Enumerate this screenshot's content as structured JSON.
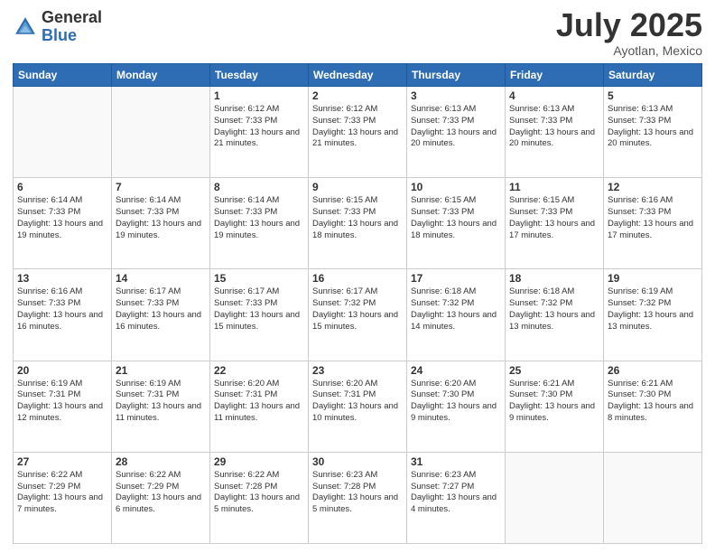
{
  "header": {
    "logo_general": "General",
    "logo_blue": "Blue",
    "title": "July 2025",
    "location": "Ayotlan, Mexico"
  },
  "days_of_week": [
    "Sunday",
    "Monday",
    "Tuesday",
    "Wednesday",
    "Thursday",
    "Friday",
    "Saturday"
  ],
  "weeks": [
    [
      {
        "day": "",
        "info": ""
      },
      {
        "day": "",
        "info": ""
      },
      {
        "day": "1",
        "info": "Sunrise: 6:12 AM\nSunset: 7:33 PM\nDaylight: 13 hours and 21 minutes."
      },
      {
        "day": "2",
        "info": "Sunrise: 6:12 AM\nSunset: 7:33 PM\nDaylight: 13 hours and 21 minutes."
      },
      {
        "day": "3",
        "info": "Sunrise: 6:13 AM\nSunset: 7:33 PM\nDaylight: 13 hours and 20 minutes."
      },
      {
        "day": "4",
        "info": "Sunrise: 6:13 AM\nSunset: 7:33 PM\nDaylight: 13 hours and 20 minutes."
      },
      {
        "day": "5",
        "info": "Sunrise: 6:13 AM\nSunset: 7:33 PM\nDaylight: 13 hours and 20 minutes."
      }
    ],
    [
      {
        "day": "6",
        "info": "Sunrise: 6:14 AM\nSunset: 7:33 PM\nDaylight: 13 hours and 19 minutes."
      },
      {
        "day": "7",
        "info": "Sunrise: 6:14 AM\nSunset: 7:33 PM\nDaylight: 13 hours and 19 minutes."
      },
      {
        "day": "8",
        "info": "Sunrise: 6:14 AM\nSunset: 7:33 PM\nDaylight: 13 hours and 19 minutes."
      },
      {
        "day": "9",
        "info": "Sunrise: 6:15 AM\nSunset: 7:33 PM\nDaylight: 13 hours and 18 minutes."
      },
      {
        "day": "10",
        "info": "Sunrise: 6:15 AM\nSunset: 7:33 PM\nDaylight: 13 hours and 18 minutes."
      },
      {
        "day": "11",
        "info": "Sunrise: 6:15 AM\nSunset: 7:33 PM\nDaylight: 13 hours and 17 minutes."
      },
      {
        "day": "12",
        "info": "Sunrise: 6:16 AM\nSunset: 7:33 PM\nDaylight: 13 hours and 17 minutes."
      }
    ],
    [
      {
        "day": "13",
        "info": "Sunrise: 6:16 AM\nSunset: 7:33 PM\nDaylight: 13 hours and 16 minutes."
      },
      {
        "day": "14",
        "info": "Sunrise: 6:17 AM\nSunset: 7:33 PM\nDaylight: 13 hours and 16 minutes."
      },
      {
        "day": "15",
        "info": "Sunrise: 6:17 AM\nSunset: 7:33 PM\nDaylight: 13 hours and 15 minutes."
      },
      {
        "day": "16",
        "info": "Sunrise: 6:17 AM\nSunset: 7:32 PM\nDaylight: 13 hours and 15 minutes."
      },
      {
        "day": "17",
        "info": "Sunrise: 6:18 AM\nSunset: 7:32 PM\nDaylight: 13 hours and 14 minutes."
      },
      {
        "day": "18",
        "info": "Sunrise: 6:18 AM\nSunset: 7:32 PM\nDaylight: 13 hours and 13 minutes."
      },
      {
        "day": "19",
        "info": "Sunrise: 6:19 AM\nSunset: 7:32 PM\nDaylight: 13 hours and 13 minutes."
      }
    ],
    [
      {
        "day": "20",
        "info": "Sunrise: 6:19 AM\nSunset: 7:31 PM\nDaylight: 13 hours and 12 minutes."
      },
      {
        "day": "21",
        "info": "Sunrise: 6:19 AM\nSunset: 7:31 PM\nDaylight: 13 hours and 11 minutes."
      },
      {
        "day": "22",
        "info": "Sunrise: 6:20 AM\nSunset: 7:31 PM\nDaylight: 13 hours and 11 minutes."
      },
      {
        "day": "23",
        "info": "Sunrise: 6:20 AM\nSunset: 7:31 PM\nDaylight: 13 hours and 10 minutes."
      },
      {
        "day": "24",
        "info": "Sunrise: 6:20 AM\nSunset: 7:30 PM\nDaylight: 13 hours and 9 minutes."
      },
      {
        "day": "25",
        "info": "Sunrise: 6:21 AM\nSunset: 7:30 PM\nDaylight: 13 hours and 9 minutes."
      },
      {
        "day": "26",
        "info": "Sunrise: 6:21 AM\nSunset: 7:30 PM\nDaylight: 13 hours and 8 minutes."
      }
    ],
    [
      {
        "day": "27",
        "info": "Sunrise: 6:22 AM\nSunset: 7:29 PM\nDaylight: 13 hours and 7 minutes."
      },
      {
        "day": "28",
        "info": "Sunrise: 6:22 AM\nSunset: 7:29 PM\nDaylight: 13 hours and 6 minutes."
      },
      {
        "day": "29",
        "info": "Sunrise: 6:22 AM\nSunset: 7:28 PM\nDaylight: 13 hours and 5 minutes."
      },
      {
        "day": "30",
        "info": "Sunrise: 6:23 AM\nSunset: 7:28 PM\nDaylight: 13 hours and 5 minutes."
      },
      {
        "day": "31",
        "info": "Sunrise: 6:23 AM\nSunset: 7:27 PM\nDaylight: 13 hours and 4 minutes."
      },
      {
        "day": "",
        "info": ""
      },
      {
        "day": "",
        "info": ""
      }
    ]
  ]
}
